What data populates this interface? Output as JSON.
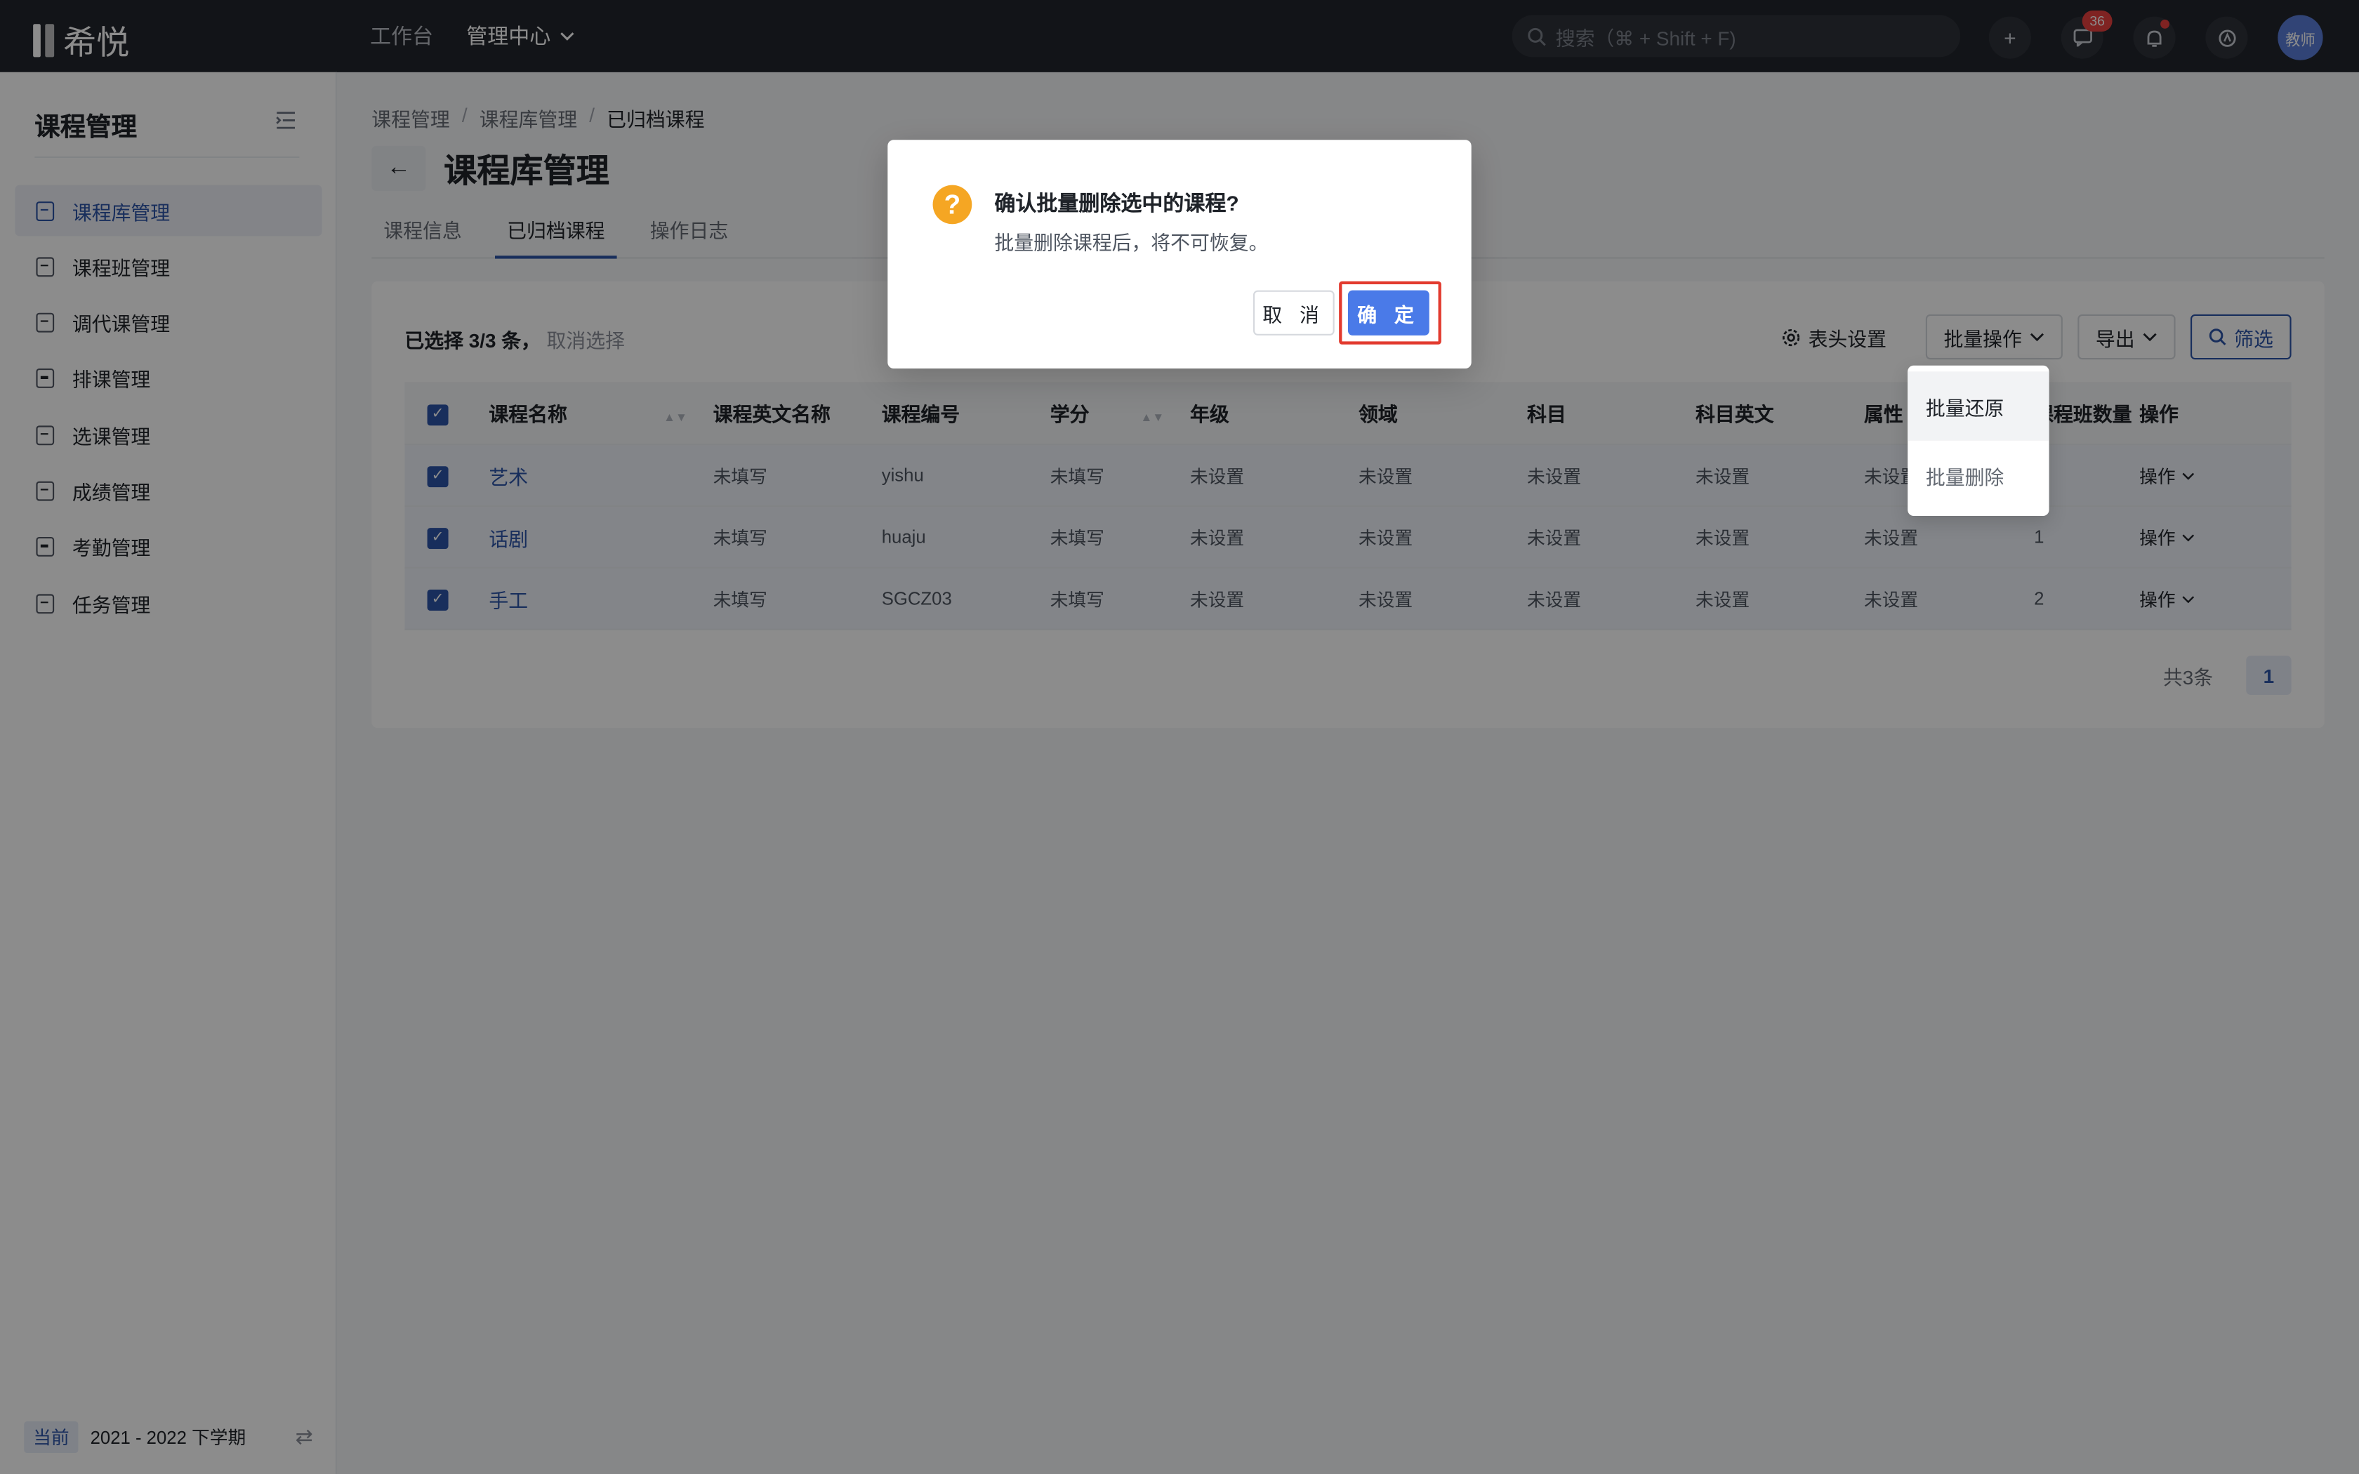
{
  "app": {
    "logo_text": "希悦"
  },
  "topnav": {
    "items": [
      "工作台",
      "管理中心"
    ]
  },
  "search": {
    "placeholder": "搜索（⌘ + Shift + F)"
  },
  "top_icons": {
    "messages_badge": "36",
    "avatar_label": "教师"
  },
  "sidebar": {
    "title": "课程管理",
    "items": [
      {
        "label": "课程库管理"
      },
      {
        "label": "课程班管理"
      },
      {
        "label": "调代课管理"
      },
      {
        "label": "排课管理"
      },
      {
        "label": "选课管理"
      },
      {
        "label": "成绩管理"
      },
      {
        "label": "考勤管理"
      },
      {
        "label": "任务管理"
      }
    ],
    "footer": {
      "tag": "当前",
      "term": "2021 - 2022 下学期"
    }
  },
  "breadcrumb": [
    "课程管理",
    "课程库管理",
    "已归档课程"
  ],
  "page": {
    "title": "课程库管理"
  },
  "tabs": [
    "课程信息",
    "已归档课程",
    "操作日志"
  ],
  "selection": {
    "text": "已选择 3/3 条，",
    "clear": "取消选择"
  },
  "toolbar": {
    "header_settings": "表头设置",
    "batch": "批量操作",
    "export": "导出",
    "filter": "筛选"
  },
  "table": {
    "columns": [
      "课程名称",
      "课程英文名称",
      "课程编号",
      "学分",
      "年级",
      "领域",
      "科目",
      "科目英文",
      "属性",
      "课程班数量",
      "操作"
    ],
    "rows": [
      {
        "name": "艺术",
        "en": "未填写",
        "code": "yishu",
        "credit": "未填写",
        "grade": "未设置",
        "field": "未设置",
        "subject": "未设置",
        "subject_en": "未设置",
        "attr": "未设置",
        "count": "",
        "op": "操作"
      },
      {
        "name": "话剧",
        "en": "未填写",
        "code": "huaju",
        "credit": "未填写",
        "grade": "未设置",
        "field": "未设置",
        "subject": "未设置",
        "subject_en": "未设置",
        "attr": "未设置",
        "count": "1",
        "op": "操作"
      },
      {
        "name": "手工",
        "en": "未填写",
        "code": "SGCZ03",
        "credit": "未填写",
        "grade": "未设置",
        "field": "未设置",
        "subject": "未设置",
        "subject_en": "未设置",
        "attr": "未设置",
        "count": "2",
        "op": "操作"
      }
    ]
  },
  "pagination": {
    "total": "共3条",
    "current": "1"
  },
  "dropdown": {
    "items": [
      "批量还原",
      "批量删除"
    ]
  },
  "dialog": {
    "title": "确认批量删除选中的课程?",
    "message": "批量删除课程后，将不可恢复。",
    "cancel": "取 消",
    "ok": "确 定"
  },
  "colors": {
    "accent": "#2d54a8",
    "primary_button": "#4a7ae8",
    "warning": "#f5a623",
    "highlight": "#e23a2e",
    "topbar": "#22252c"
  }
}
